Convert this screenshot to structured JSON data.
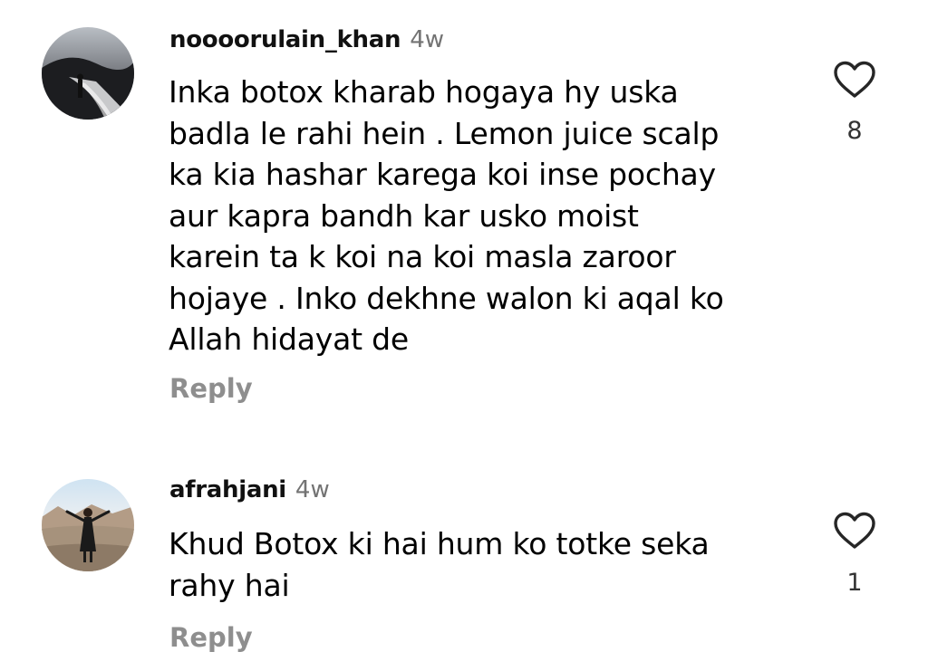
{
  "comments": [
    {
      "username": "noooorulain_khan",
      "timestamp": "4w",
      "lines": [
        "Inka botox kharab hogaya hy uska",
        "badla le rahi hein . Lemon juice scalp",
        "ka kia hashar karega koi inse pochay",
        "aur kapra bandh kar usko moist",
        "karein ta k koi na koi masla zaroor",
        "hojaye . Inko dekhne walon ki aqal ko",
        "Allah hidayat de"
      ],
      "likes": "8",
      "reply_label": "Reply"
    },
    {
      "username": "afrahjani",
      "timestamp": "4w",
      "lines": [
        "Khud Botox ki hai hum ko totke seka",
        "rahy hai"
      ],
      "likes": "1",
      "reply_label": "Reply"
    }
  ],
  "icons": {
    "like": "heart-outline-icon"
  },
  "colors": {
    "username": "#111111",
    "timestamp": "#737373",
    "reply": "#8e8e8e",
    "heart_stroke": "#262626"
  }
}
